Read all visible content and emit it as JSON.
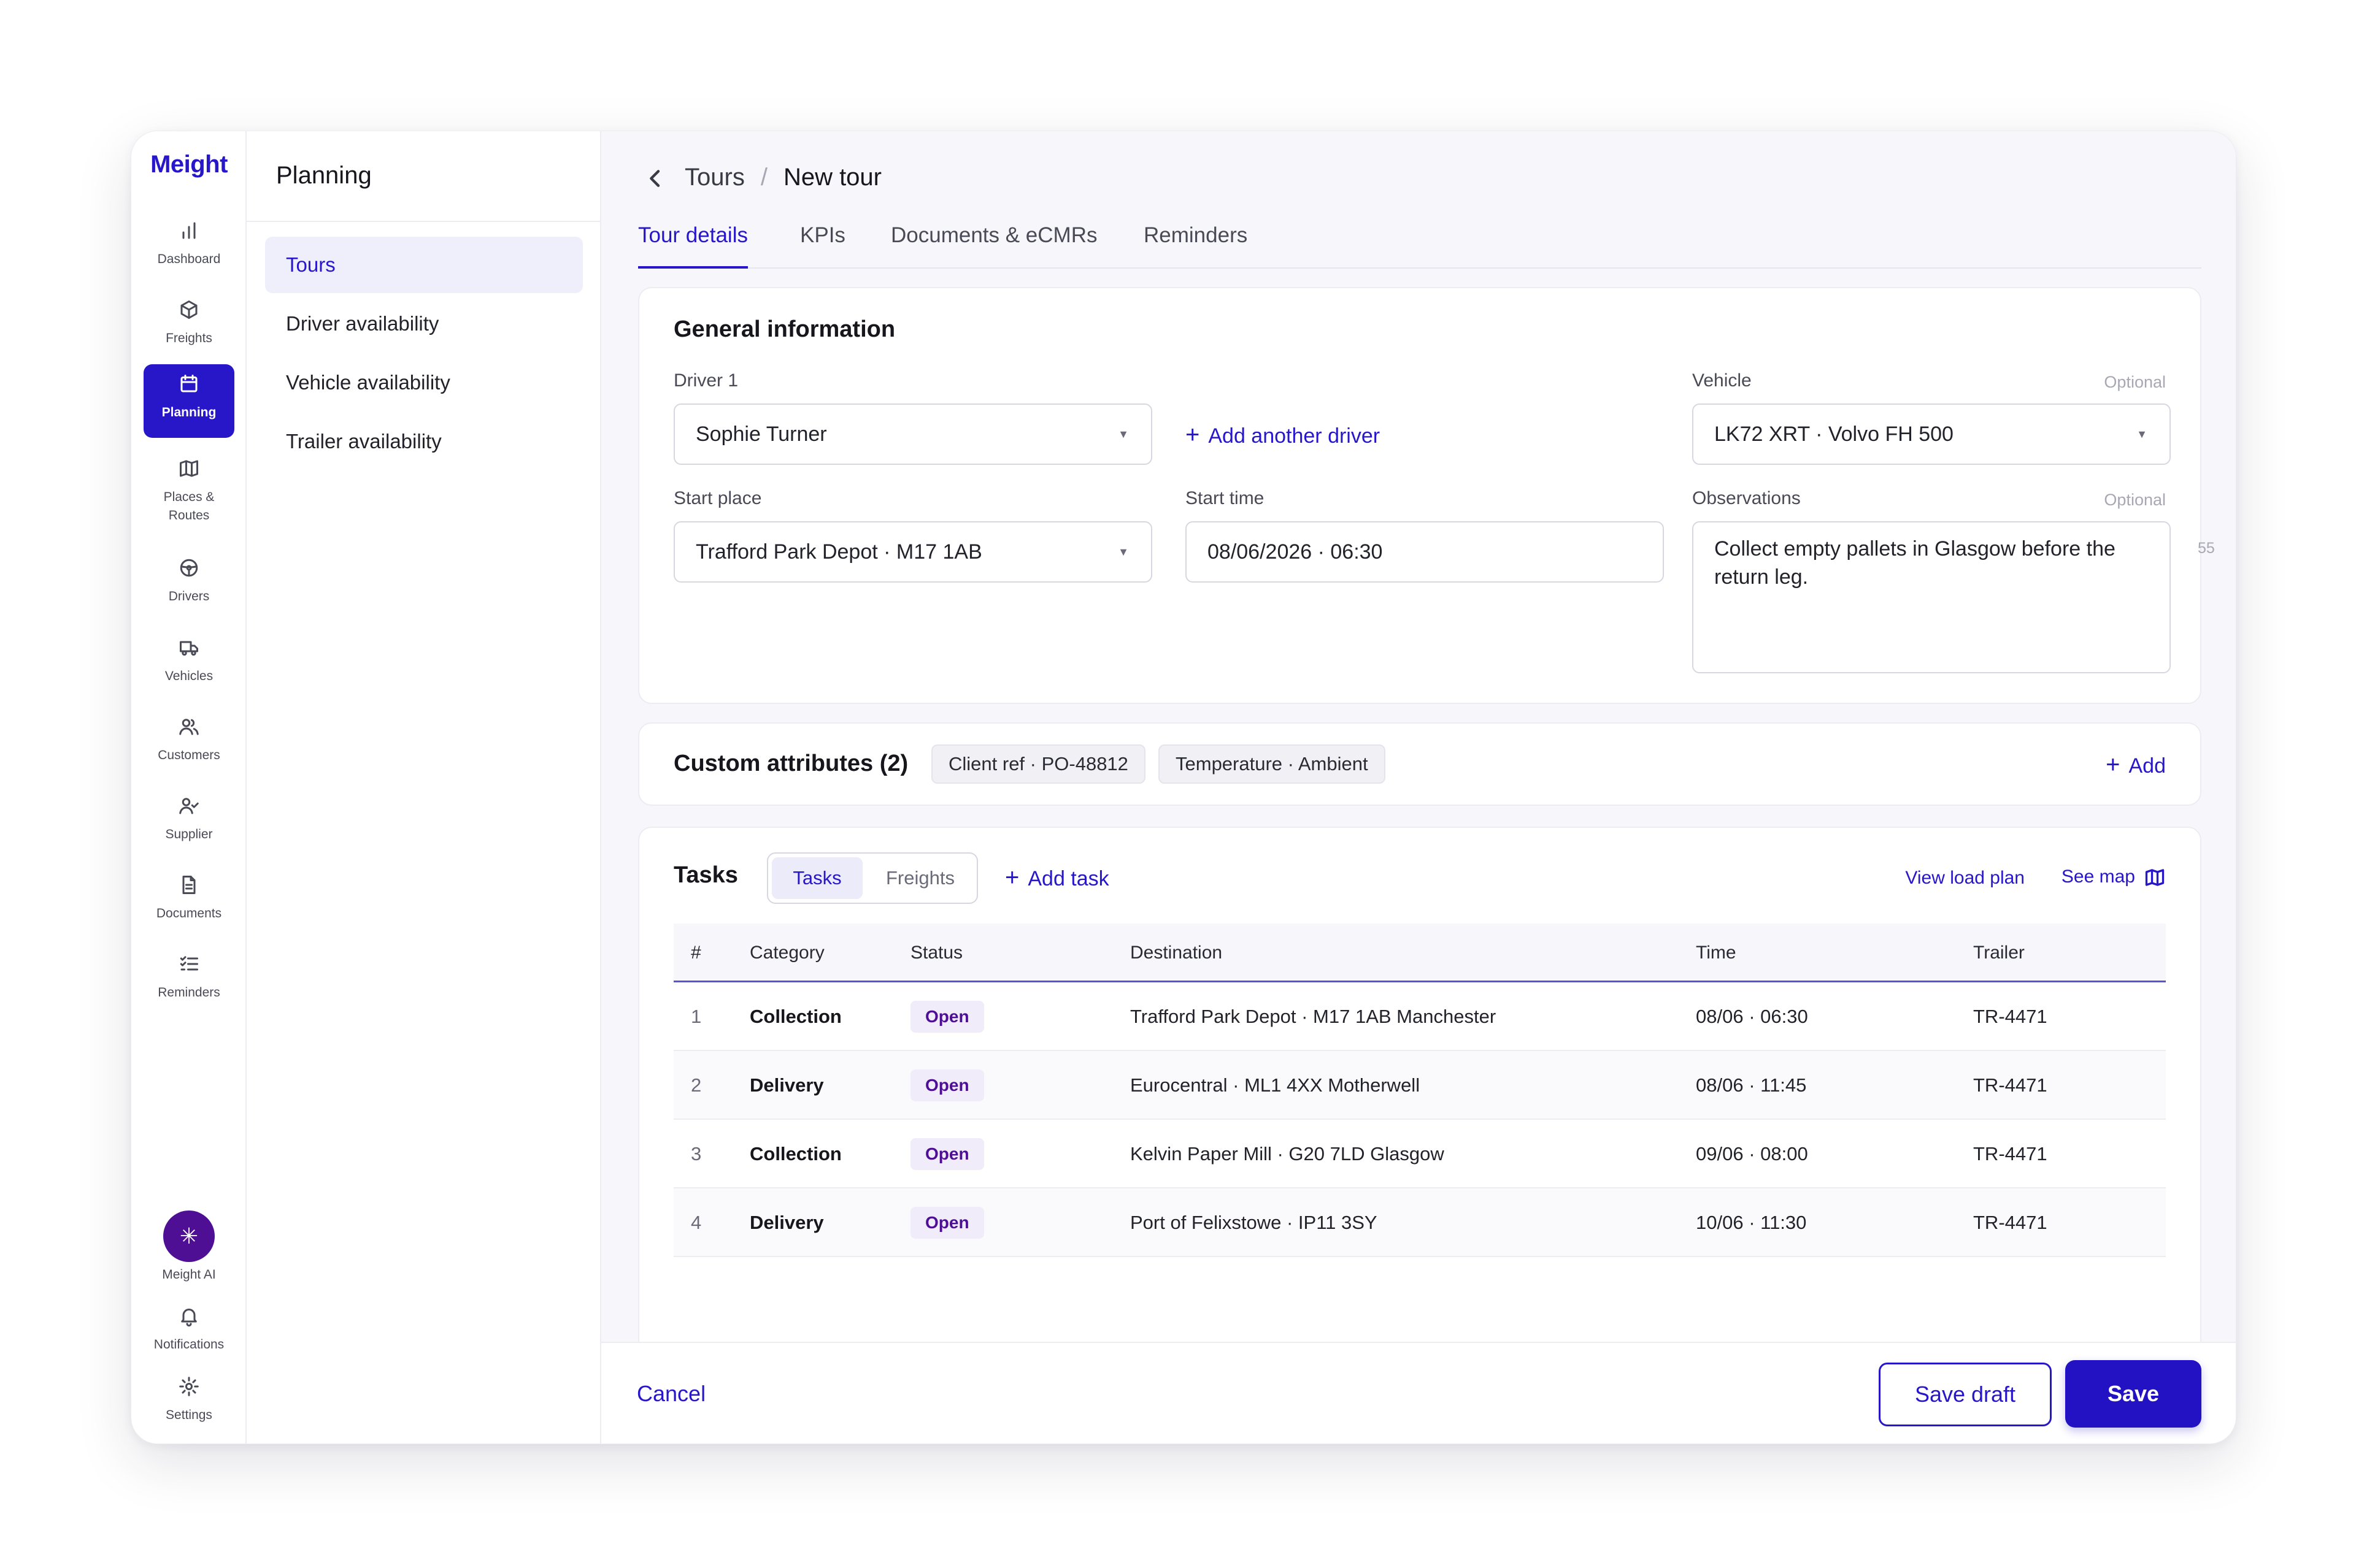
{
  "app": {
    "brand": "Meight"
  },
  "rail": {
    "items": [
      {
        "label": "Dashboard",
        "icon": "bar-chart-icon"
      },
      {
        "label": "Freights",
        "icon": "box-icon"
      },
      {
        "label": "Planning",
        "icon": "calendar-icon",
        "active": true
      },
      {
        "label": "Places & Routes",
        "icon": "map-icon"
      },
      {
        "label": "Drivers",
        "icon": "steering-wheel-icon"
      },
      {
        "label": "Vehicles",
        "icon": "truck-icon"
      },
      {
        "label": "Customers",
        "icon": "users-icon"
      },
      {
        "label": "Supplier",
        "icon": "user-check-icon"
      },
      {
        "label": "Documents",
        "icon": "document-icon"
      },
      {
        "label": "Reminders",
        "icon": "checklist-icon"
      }
    ],
    "bottom": [
      {
        "label": "Meight AI",
        "icon": "sparkle-icon"
      },
      {
        "label": "Notifications",
        "icon": "bell-icon"
      },
      {
        "label": "Settings",
        "icon": "gear-icon"
      }
    ]
  },
  "subnav": {
    "title": "Planning",
    "items": [
      {
        "label": "Tours",
        "active": true
      },
      {
        "label": "Driver availability"
      },
      {
        "label": "Vehicle availability"
      },
      {
        "label": "Trailer availability"
      }
    ]
  },
  "breadcrumb": {
    "parent": "Tours",
    "separator": "/",
    "current": "New tour"
  },
  "tabs": [
    {
      "label": "Tour details",
      "active": true
    },
    {
      "label": "KPIs"
    },
    {
      "label": "Documents & eCMRs"
    },
    {
      "label": "Reminders"
    }
  ],
  "general": {
    "title": "General information",
    "driver_label": "Driver 1",
    "driver_value": "Sophie Turner",
    "add_driver": "Add another driver",
    "vehicle_label": "Vehicle",
    "vehicle_optional": "Optional",
    "vehicle_value": "LK72 XRT · Volvo FH 500",
    "start_place_label": "Start place",
    "start_place_value": "Trafford Park Depot · M17 1AB",
    "start_time_label": "Start time",
    "start_time_value": "08/06/2026 · 06:30",
    "observations_label": "Observations",
    "observations_optional": "Optional",
    "observations_value": "Collect empty pallets in Glasgow before the return leg.",
    "observations_count": "55"
  },
  "custom": {
    "title": "Custom attributes (2)",
    "chips": [
      "Client ref · PO-48812",
      "Temperature · Ambient"
    ],
    "add": "Add"
  },
  "tasks": {
    "title": "Tasks",
    "toggle": [
      "Tasks",
      "Freights"
    ],
    "add_task": "Add task",
    "view_load_plan": "View load plan",
    "see_map": "See map",
    "columns": [
      "#",
      "Category",
      "Status",
      "Destination",
      "Time",
      "Trailer"
    ],
    "rows": [
      {
        "num": "1",
        "category": "Collection",
        "status": "Open",
        "destination": "Trafford Park Depot · M17 1AB Manchester",
        "time": "08/06 · 06:30",
        "trailer": "TR-4471"
      },
      {
        "num": "2",
        "category": "Delivery",
        "status": "Open",
        "destination": "Eurocentral · ML1 4XX Motherwell",
        "time": "08/06 · 11:45",
        "trailer": "TR-4471"
      },
      {
        "num": "3",
        "category": "Collection",
        "status": "Open",
        "destination": "Kelvin Paper Mill · G20 7LD Glasgow",
        "time": "09/06 · 08:00",
        "trailer": "TR-4471"
      },
      {
        "num": "4",
        "category": "Delivery",
        "status": "Open",
        "destination": "Port of Felixstowe · IP11 3SY",
        "time": "10/06 · 11:30",
        "trailer": "TR-4471"
      }
    ]
  },
  "footer": {
    "cancel": "Cancel",
    "save_draft": "Save draft",
    "save": "Save"
  },
  "colors": {
    "accent": "#2717c9",
    "ai": "#4e0f95",
    "badge_bg": "#f0ecfa"
  }
}
